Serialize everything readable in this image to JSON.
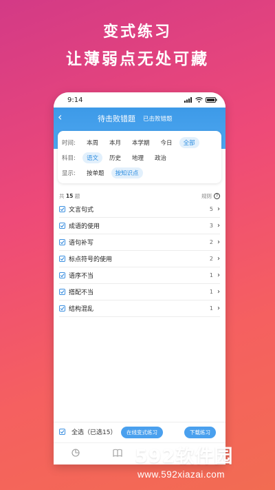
{
  "promo": {
    "line1": "变式练习",
    "line2": "让薄弱点无处可藏"
  },
  "status_bar": {
    "time": "9:14"
  },
  "header": {
    "back_icon": "chevron-left-icon",
    "tab_active": "待击败错题",
    "tab_inactive": "已击败错题"
  },
  "filters": {
    "time": {
      "label": "时间:",
      "options": [
        "本周",
        "本月",
        "本学期",
        "今日",
        "全部"
      ],
      "selected": "全部"
    },
    "subject": {
      "label": "科目:",
      "options": [
        "语文",
        "历史",
        "地理",
        "政治"
      ],
      "selected": "语文"
    },
    "display": {
      "label": "显示:",
      "options": [
        "按单题",
        "按知识点"
      ],
      "selected": "按知识点"
    }
  },
  "summary": {
    "prefix": "共",
    "count": "15",
    "suffix": "题",
    "rule_label": "规则"
  },
  "items": [
    {
      "name": "文言句式",
      "count": "5",
      "checked": true
    },
    {
      "name": "成语的使用",
      "count": "3",
      "checked": true
    },
    {
      "name": "语句补写",
      "count": "2",
      "checked": true
    },
    {
      "name": "标点符号的使用",
      "count": "2",
      "checked": true
    },
    {
      "name": "语序不当",
      "count": "1",
      "checked": true
    },
    {
      "name": "搭配不当",
      "count": "1",
      "checked": true
    },
    {
      "name": "结构混乱",
      "count": "1",
      "checked": true
    }
  ],
  "bottom": {
    "select_all": "全选（已选15）",
    "practice_button": "在线变式练习",
    "download_button": "下载练习"
  },
  "watermark": {
    "brand": "592软件园",
    "url": "www.592xiazai.com"
  },
  "colors": {
    "accent": "#4aa0ee",
    "header": "#3d9ae8",
    "background_top": "#d33a86",
    "background_bottom": "#f26c52"
  }
}
